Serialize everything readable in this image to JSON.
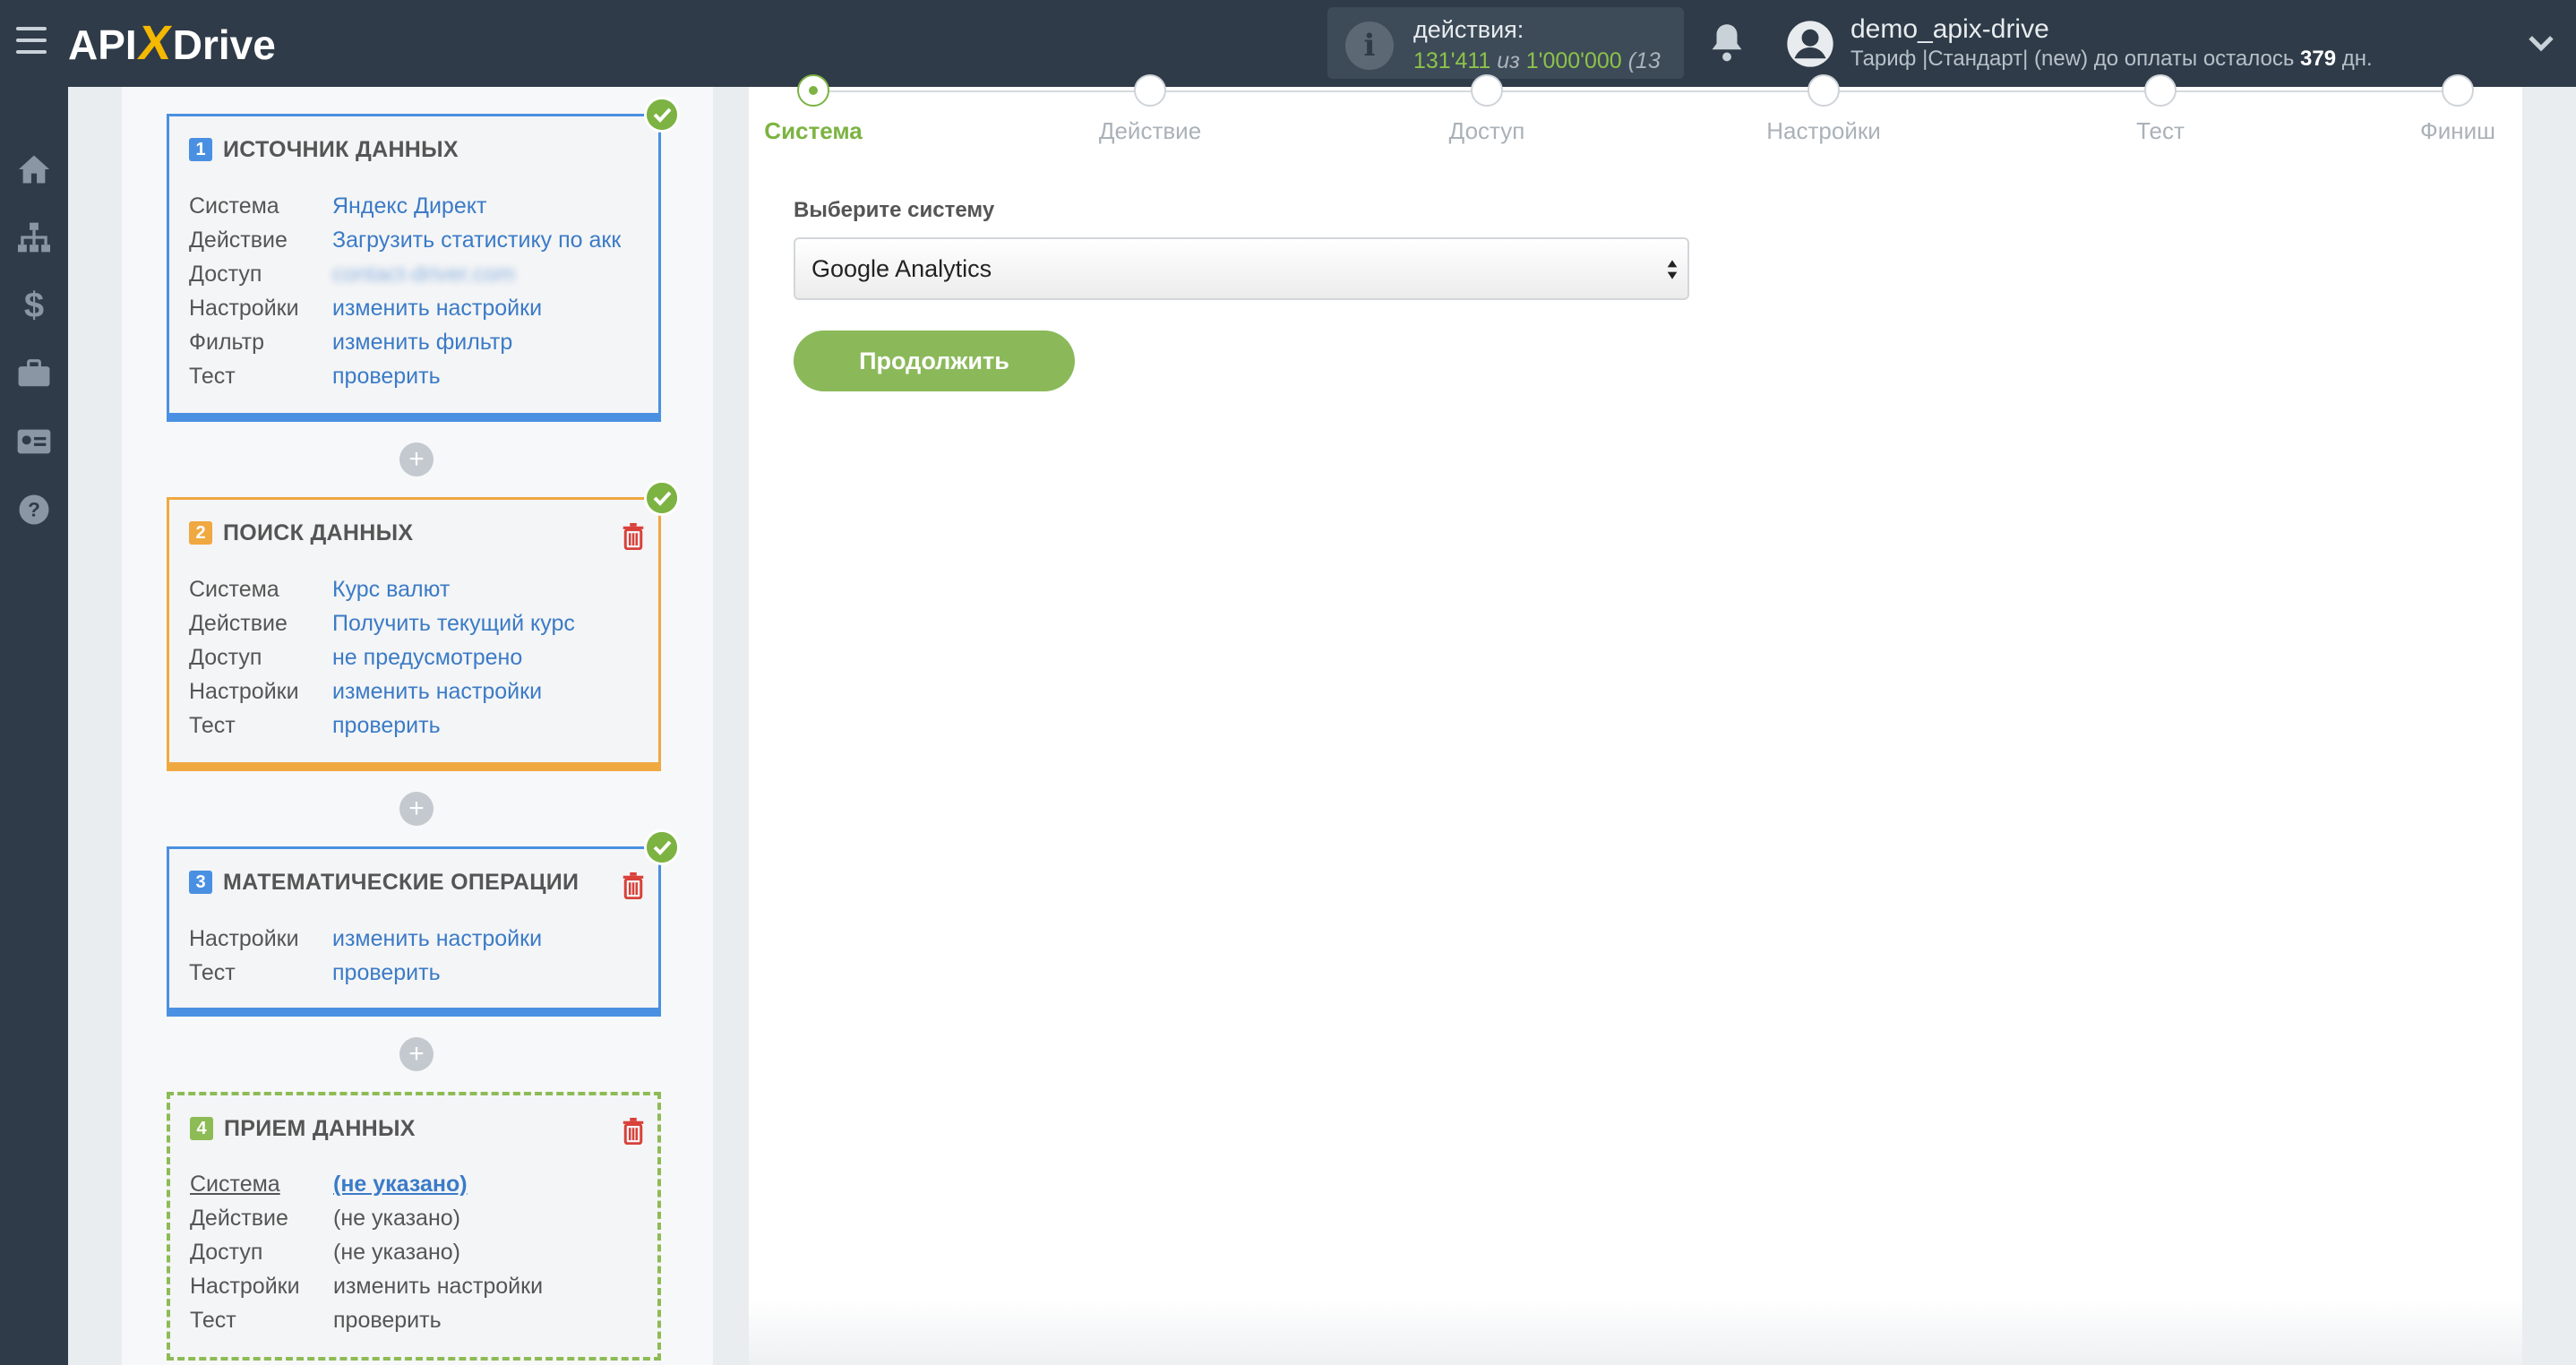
{
  "header": {
    "logo_left": "API",
    "logo_x": "X",
    "logo_right": "Drive",
    "actions_title": "действия:",
    "actions_used": "131'411",
    "actions_of": "из",
    "actions_total": "1'000'000",
    "actions_extra": "(13",
    "username": "demo_apix-drive",
    "tariff_text": "Тариф |Стандарт| (new) до оплаты осталось",
    "tariff_days": "379",
    "tariff_unit": "дн."
  },
  "sidebar_icons": [
    "home-icon",
    "sitemap-icon",
    "dollar-icon",
    "briefcase-icon",
    "id-card-icon",
    "help-icon"
  ],
  "cards": [
    {
      "number": "1",
      "title": "ИСТОЧНИК ДАННЫХ",
      "rows": [
        {
          "k": "Система",
          "v": "Яндекс Директ"
        },
        {
          "k": "Действие",
          "v": "Загрузить статистику по акк"
        },
        {
          "k": "Доступ",
          "v": "contact-driver.com"
        },
        {
          "k": "Настройки",
          "v": "изменить настройки"
        },
        {
          "k": "Фильтр",
          "v": "изменить фильтр"
        },
        {
          "k": "Тест",
          "v": "проверить"
        }
      ]
    },
    {
      "number": "2",
      "title": "ПОИСК ДАННЫХ",
      "rows": [
        {
          "k": "Система",
          "v": "Курс валют"
        },
        {
          "k": "Действие",
          "v": "Получить текущий курс"
        },
        {
          "k": "Доступ",
          "v": "не предусмотрено"
        },
        {
          "k": "Настройки",
          "v": "изменить настройки"
        },
        {
          "k": "Тест",
          "v": "проверить"
        }
      ]
    },
    {
      "number": "3",
      "title": "МАТЕМАТИЧЕСКИЕ ОПЕРАЦИИ",
      "rows": [
        {
          "k": "Настройки",
          "v": "изменить настройки"
        },
        {
          "k": "Тест",
          "v": "проверить"
        }
      ]
    },
    {
      "number": "4",
      "title": "ПРИЕМ ДАННЫХ",
      "rows": [
        {
          "k": "Система",
          "v": "(не указано)"
        },
        {
          "k": "Действие",
          "v": "(не указано)"
        },
        {
          "k": "Доступ",
          "v": "(не указано)"
        },
        {
          "k": "Настройки",
          "v": "изменить настройки"
        },
        {
          "k": "Тест",
          "v": "проверить"
        }
      ]
    }
  ],
  "steps": [
    "Система",
    "Действие",
    "Доступ",
    "Настройки",
    "Тест",
    "Финиш"
  ],
  "active_step": "Система",
  "form": {
    "label": "Выберите систему",
    "selected": "Google Analytics",
    "continue_label": "Продолжить"
  },
  "colors": {
    "topbar": "#2f3b48",
    "accent_green": "#8bb95a",
    "link_blue": "#3b7bc7",
    "card_blue": "#4a90e2",
    "card_orange": "#f0a841",
    "danger_red": "#d9413a"
  }
}
